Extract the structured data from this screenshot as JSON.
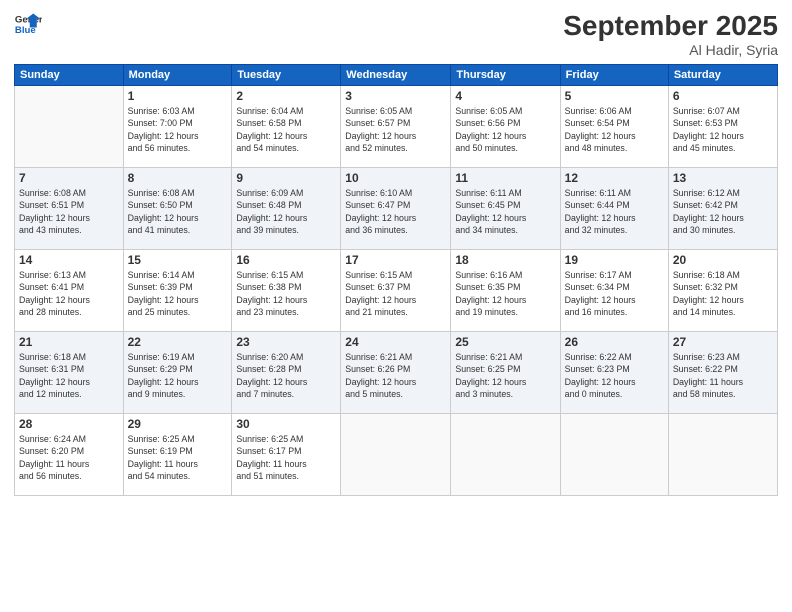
{
  "header": {
    "logo_line1": "General",
    "logo_line2": "Blue",
    "month": "September 2025",
    "location": "Al Hadir, Syria"
  },
  "days_of_week": [
    "Sunday",
    "Monday",
    "Tuesday",
    "Wednesday",
    "Thursday",
    "Friday",
    "Saturday"
  ],
  "weeks": [
    [
      {
        "num": "",
        "info": ""
      },
      {
        "num": "1",
        "info": "Sunrise: 6:03 AM\nSunset: 7:00 PM\nDaylight: 12 hours\nand 56 minutes."
      },
      {
        "num": "2",
        "info": "Sunrise: 6:04 AM\nSunset: 6:58 PM\nDaylight: 12 hours\nand 54 minutes."
      },
      {
        "num": "3",
        "info": "Sunrise: 6:05 AM\nSunset: 6:57 PM\nDaylight: 12 hours\nand 52 minutes."
      },
      {
        "num": "4",
        "info": "Sunrise: 6:05 AM\nSunset: 6:56 PM\nDaylight: 12 hours\nand 50 minutes."
      },
      {
        "num": "5",
        "info": "Sunrise: 6:06 AM\nSunset: 6:54 PM\nDaylight: 12 hours\nand 48 minutes."
      },
      {
        "num": "6",
        "info": "Sunrise: 6:07 AM\nSunset: 6:53 PM\nDaylight: 12 hours\nand 45 minutes."
      }
    ],
    [
      {
        "num": "7",
        "info": "Sunrise: 6:08 AM\nSunset: 6:51 PM\nDaylight: 12 hours\nand 43 minutes."
      },
      {
        "num": "8",
        "info": "Sunrise: 6:08 AM\nSunset: 6:50 PM\nDaylight: 12 hours\nand 41 minutes."
      },
      {
        "num": "9",
        "info": "Sunrise: 6:09 AM\nSunset: 6:48 PM\nDaylight: 12 hours\nand 39 minutes."
      },
      {
        "num": "10",
        "info": "Sunrise: 6:10 AM\nSunset: 6:47 PM\nDaylight: 12 hours\nand 36 minutes."
      },
      {
        "num": "11",
        "info": "Sunrise: 6:11 AM\nSunset: 6:45 PM\nDaylight: 12 hours\nand 34 minutes."
      },
      {
        "num": "12",
        "info": "Sunrise: 6:11 AM\nSunset: 6:44 PM\nDaylight: 12 hours\nand 32 minutes."
      },
      {
        "num": "13",
        "info": "Sunrise: 6:12 AM\nSunset: 6:42 PM\nDaylight: 12 hours\nand 30 minutes."
      }
    ],
    [
      {
        "num": "14",
        "info": "Sunrise: 6:13 AM\nSunset: 6:41 PM\nDaylight: 12 hours\nand 28 minutes."
      },
      {
        "num": "15",
        "info": "Sunrise: 6:14 AM\nSunset: 6:39 PM\nDaylight: 12 hours\nand 25 minutes."
      },
      {
        "num": "16",
        "info": "Sunrise: 6:15 AM\nSunset: 6:38 PM\nDaylight: 12 hours\nand 23 minutes."
      },
      {
        "num": "17",
        "info": "Sunrise: 6:15 AM\nSunset: 6:37 PM\nDaylight: 12 hours\nand 21 minutes."
      },
      {
        "num": "18",
        "info": "Sunrise: 6:16 AM\nSunset: 6:35 PM\nDaylight: 12 hours\nand 19 minutes."
      },
      {
        "num": "19",
        "info": "Sunrise: 6:17 AM\nSunset: 6:34 PM\nDaylight: 12 hours\nand 16 minutes."
      },
      {
        "num": "20",
        "info": "Sunrise: 6:18 AM\nSunset: 6:32 PM\nDaylight: 12 hours\nand 14 minutes."
      }
    ],
    [
      {
        "num": "21",
        "info": "Sunrise: 6:18 AM\nSunset: 6:31 PM\nDaylight: 12 hours\nand 12 minutes."
      },
      {
        "num": "22",
        "info": "Sunrise: 6:19 AM\nSunset: 6:29 PM\nDaylight: 12 hours\nand 9 minutes."
      },
      {
        "num": "23",
        "info": "Sunrise: 6:20 AM\nSunset: 6:28 PM\nDaylight: 12 hours\nand 7 minutes."
      },
      {
        "num": "24",
        "info": "Sunrise: 6:21 AM\nSunset: 6:26 PM\nDaylight: 12 hours\nand 5 minutes."
      },
      {
        "num": "25",
        "info": "Sunrise: 6:21 AM\nSunset: 6:25 PM\nDaylight: 12 hours\nand 3 minutes."
      },
      {
        "num": "26",
        "info": "Sunrise: 6:22 AM\nSunset: 6:23 PM\nDaylight: 12 hours\nand 0 minutes."
      },
      {
        "num": "27",
        "info": "Sunrise: 6:23 AM\nSunset: 6:22 PM\nDaylight: 11 hours\nand 58 minutes."
      }
    ],
    [
      {
        "num": "28",
        "info": "Sunrise: 6:24 AM\nSunset: 6:20 PM\nDaylight: 11 hours\nand 56 minutes."
      },
      {
        "num": "29",
        "info": "Sunrise: 6:25 AM\nSunset: 6:19 PM\nDaylight: 11 hours\nand 54 minutes."
      },
      {
        "num": "30",
        "info": "Sunrise: 6:25 AM\nSunset: 6:17 PM\nDaylight: 11 hours\nand 51 minutes."
      },
      {
        "num": "",
        "info": ""
      },
      {
        "num": "",
        "info": ""
      },
      {
        "num": "",
        "info": ""
      },
      {
        "num": "",
        "info": ""
      }
    ]
  ]
}
